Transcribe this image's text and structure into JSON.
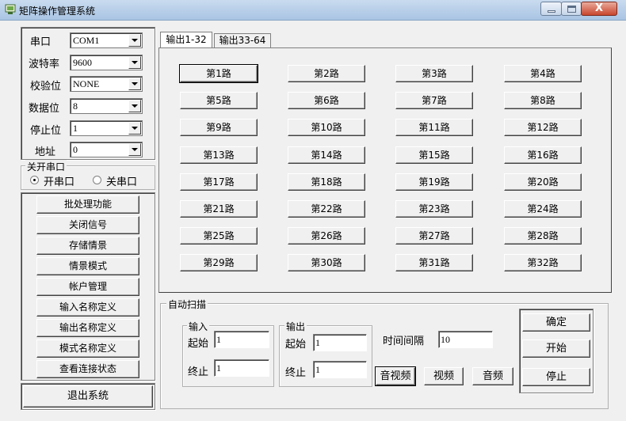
{
  "window": {
    "title": "矩阵操作管理系统",
    "close_glyph": "X"
  },
  "serial": {
    "fields": [
      {
        "label": "串口",
        "value": "COM1"
      },
      {
        "label": "波特率",
        "value": "9600"
      },
      {
        "label": "校验位",
        "value": "NONE"
      },
      {
        "label": "数据位",
        "value": "8"
      },
      {
        "label": "停止位",
        "value": "1"
      },
      {
        "label": "地址",
        "value": "0"
      }
    ]
  },
  "port_group": {
    "title": "关开串口",
    "open_label": "开串口",
    "close_label": "关串口",
    "selected": "open"
  },
  "menu": {
    "buttons": [
      "批处理功能",
      "关闭信号",
      "存储情景",
      "情景模式",
      "帐户管理",
      "输入名称定义",
      "输出名称定义",
      "模式名称定义",
      "查看连接状态"
    ],
    "exit": "退出系统"
  },
  "tabs": [
    {
      "label": "输出1-32",
      "active": true
    },
    {
      "label": "输出33-64",
      "active": false
    }
  ],
  "outputs": [
    "第1路",
    "第2路",
    "第3路",
    "第4路",
    "第5路",
    "第6路",
    "第7路",
    "第8路",
    "第9路",
    "第10路",
    "第11路",
    "第12路",
    "第13路",
    "第14路",
    "第15路",
    "第16路",
    "第17路",
    "第18路",
    "第19路",
    "第20路",
    "第21路",
    "第22路",
    "第23路",
    "第24路",
    "第25路",
    "第26路",
    "第27路",
    "第28路",
    "第29路",
    "第30路",
    "第31路",
    "第32路"
  ],
  "autoscan": {
    "title": "自动扫描",
    "input": {
      "title": "输入",
      "start_label": "起始",
      "start": "1",
      "end_label": "终止",
      "end": "1"
    },
    "output": {
      "title": "输出",
      "start_label": "起始",
      "start": "1",
      "end_label": "终止",
      "end": "1"
    },
    "interval_label": "时间间隔",
    "interval": "10",
    "mode_buttons": [
      "音视频",
      "视频",
      "音频"
    ],
    "confirm": "确定",
    "start": "开始",
    "stop": "停止"
  }
}
